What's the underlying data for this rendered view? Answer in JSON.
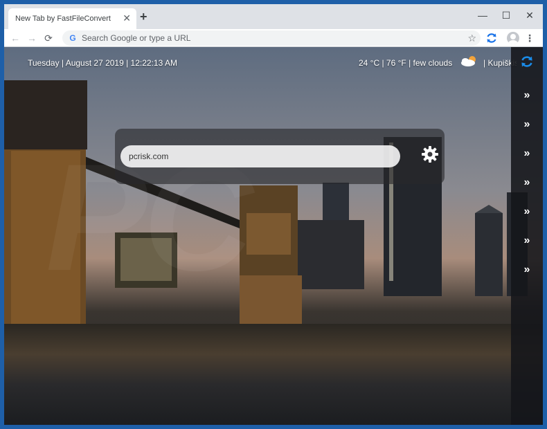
{
  "browser": {
    "tab_title": "New Tab by FastFileConvert",
    "tab_close": "✕",
    "new_tab": "+",
    "window_controls": {
      "minimize": "—",
      "maximize": "☐",
      "close": "✕"
    },
    "nav": {
      "back": "←",
      "forward": "→",
      "reload": "⟳"
    },
    "omnibox_placeholder": "Search Google or type a URL",
    "google_icon": "G",
    "star": "☆",
    "menu": "⋮"
  },
  "page": {
    "datetime": "Tuesday | August 27 2019 | 12:22:13 AM",
    "weather": "24 °C | 76 °F | few clouds",
    "weather_icon": "few-clouds-icon",
    "location": "| Kupiškis",
    "search": {
      "value": "pcrisk.com"
    },
    "sidebar": {
      "chevrons": [
        "»",
        "»",
        "»",
        "»",
        "»",
        "»",
        "»"
      ]
    }
  },
  "colors": {
    "accent": "#1a73e8",
    "window_frame": "#1e5fa8",
    "sidebar_bg": "#141619"
  }
}
